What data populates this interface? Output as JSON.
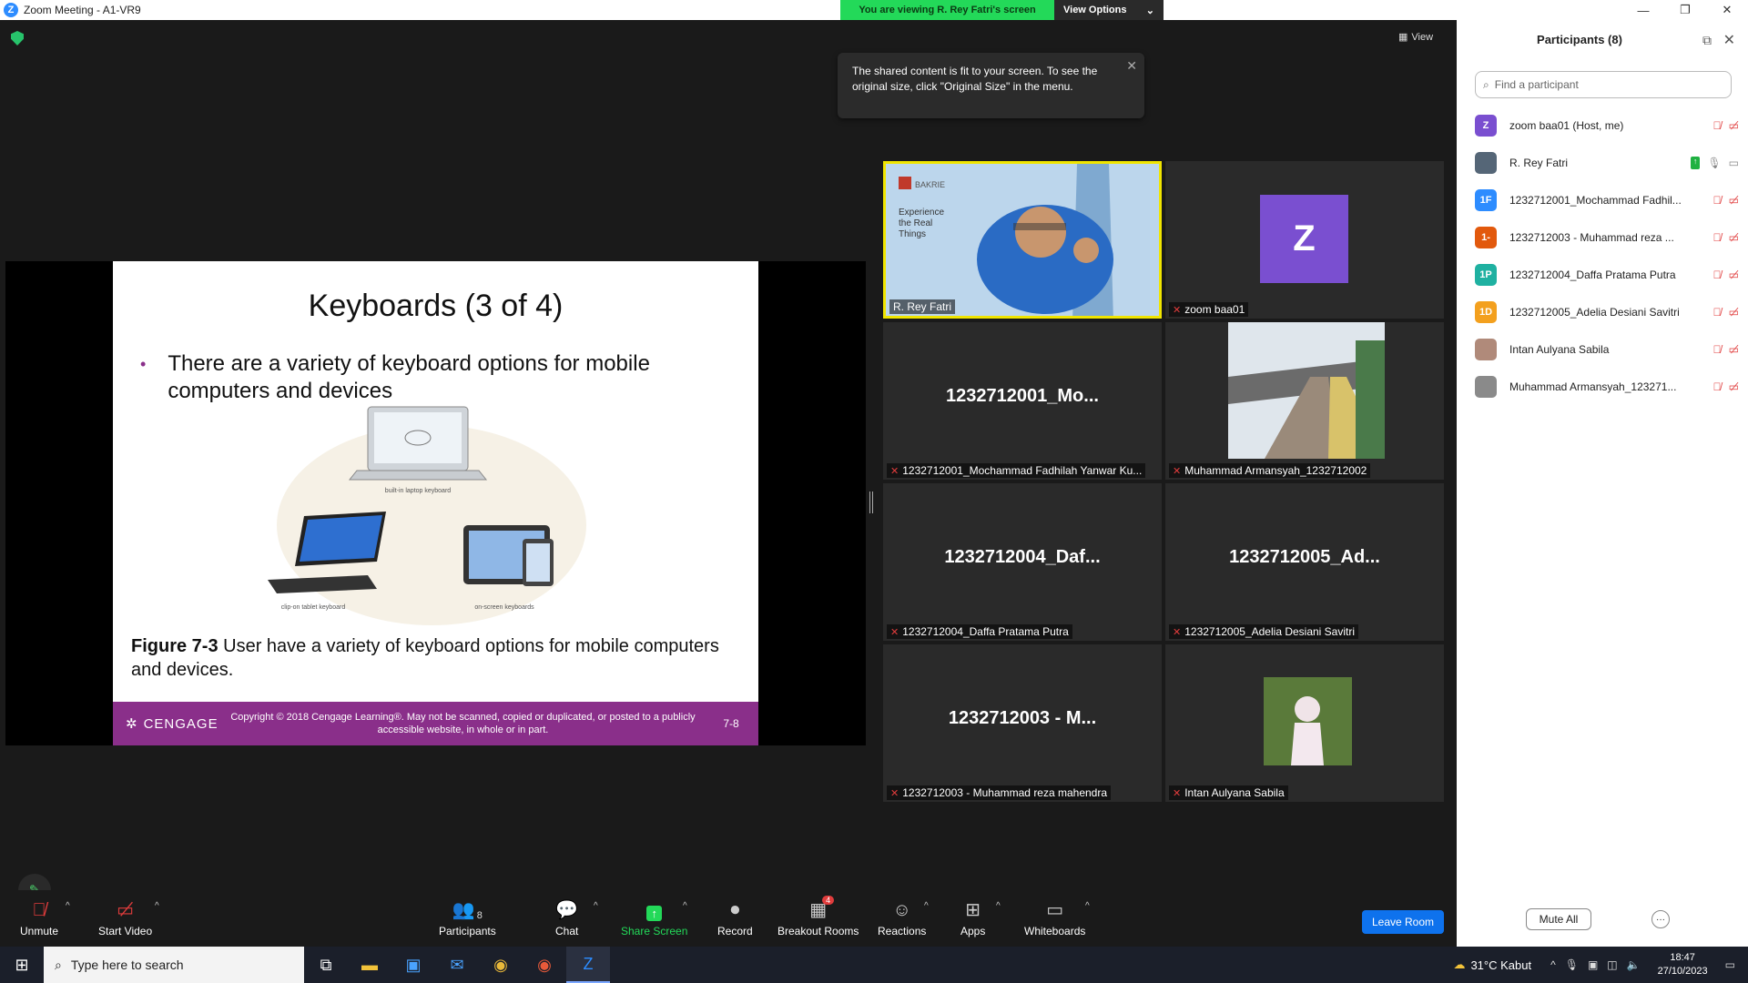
{
  "window": {
    "title": "Zoom Meeting - A1-VR9",
    "viewing_banner": "You are viewing R. Rey Fatri's screen",
    "view_options": "View Options",
    "view_button": "View"
  },
  "tooltip": {
    "text": "The shared content is fit to your screen. To see the original size, click \"Original Size\" in the menu."
  },
  "slide": {
    "title": "Keyboards (3 of 4)",
    "bullet": "There are a variety of keyboard options for mobile computers and devices",
    "labels": {
      "laptop": "built-in laptop keyboard",
      "tablet": "clip-on tablet keyboard",
      "onscreen": "on-screen keyboards"
    },
    "caption_bold": "Figure 7-3",
    "caption_rest": " User have a variety of keyboard options for mobile computers and devices.",
    "brand": "CENGAGE",
    "copyright": "Copyright © 2018 Cengage Learning®. May not be scanned, copied or duplicated, or posted to a publicly accessible website, in whole or in part.",
    "page": "7-8"
  },
  "speaker_tile": {
    "logo": "BAKRIE",
    "tagline": "Experience the Real Things"
  },
  "tiles": [
    {
      "big": "",
      "label": "R. Rey Fatri"
    },
    {
      "big": "",
      "label": "zoom baa01",
      "avatar_letter": "Z"
    },
    {
      "big": "1232712001_Mo...",
      "label": "1232712001_Mochammad Fadhilah Yanwar Ku..."
    },
    {
      "big": "",
      "label": "Muhammad Armansyah_1232712002"
    },
    {
      "big": "1232712004_Daf...",
      "label": "1232712004_Daffa Pratama Putra"
    },
    {
      "big": "1232712005_Ad...",
      "label": "1232712005_Adelia Desiani Savitri"
    },
    {
      "big": "1232712003 - M...",
      "label": "1232712003 - Muhammad reza mahendra"
    },
    {
      "big": "",
      "label": "Intan Aulyana Sabila"
    }
  ],
  "participants": {
    "title": "Participants (8)",
    "search_placeholder": "Find a participant",
    "list": [
      {
        "initials": "Z",
        "color": "#7a4fd0",
        "name": "zoom baa01 (Host, me)"
      },
      {
        "initials": "",
        "color": "#556677",
        "name": "R. Rey Fatri"
      },
      {
        "initials": "1F",
        "color": "#2d8cff",
        "name": "1232712001_Mochammad Fadhil..."
      },
      {
        "initials": "1-",
        "color": "#e2590d",
        "name": "1232712003 - Muhammad reza ..."
      },
      {
        "initials": "1P",
        "color": "#1fb1a1",
        "name": "1232712004_Daffa Pratama Putra"
      },
      {
        "initials": "1D",
        "color": "#f3a01e",
        "name": "1232712005_Adelia Desiani Savitri"
      },
      {
        "initials": "",
        "color": "#b08a7a",
        "name": "Intan Aulyana Sabila"
      },
      {
        "initials": "",
        "color": "#8a8a8a",
        "name": "Muhammad Armansyah_123271..."
      }
    ],
    "mute_all": "Mute All",
    "more": "···"
  },
  "toolbar": {
    "unmute": "Unmute",
    "start_video": "Start Video",
    "participants": "Participants",
    "participants_count": "8",
    "chat": "Chat",
    "share_screen": "Share Screen",
    "record": "Record",
    "breakout_rooms": "Breakout Rooms",
    "breakout_badge": "4",
    "reactions": "Reactions",
    "apps": "Apps",
    "whiteboards": "Whiteboards",
    "leave": "Leave Room"
  },
  "taskbar": {
    "search_placeholder": "Type here to search",
    "weather": "31°C  Kabut",
    "time": "18:47",
    "date": "27/10/2023"
  }
}
